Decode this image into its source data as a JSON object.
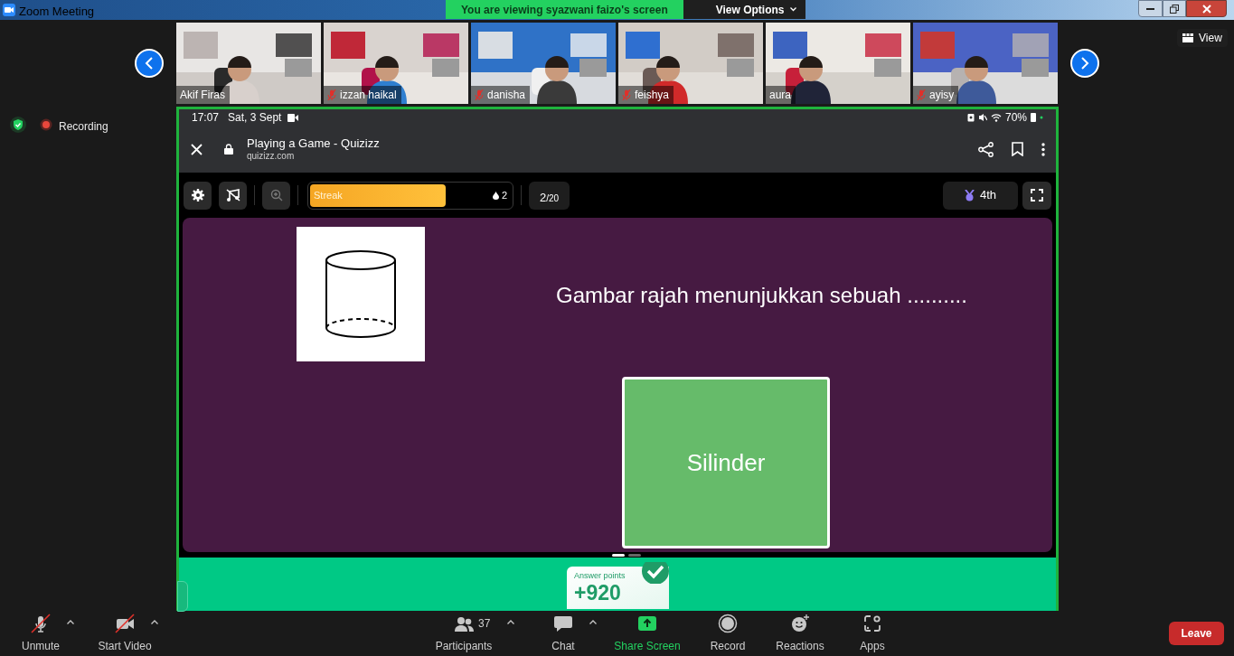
{
  "window": {
    "title": "Zoom Meeting"
  },
  "banner": {
    "text": "You are viewing syazwani faizo's screen",
    "options": "View Options"
  },
  "view_button": "View",
  "video_strip": [
    {
      "name": "Akif Firas",
      "muted": false
    },
    {
      "name": "izzan haikal",
      "muted": true
    },
    {
      "name": "danisha",
      "muted": true
    },
    {
      "name": "feishya",
      "muted": true
    },
    {
      "name": "aura",
      "muted": false
    },
    {
      "name": "ayisy",
      "muted": true
    }
  ],
  "recording": "Recording",
  "shared_screen": {
    "status_bar": {
      "time": "17:07",
      "date": "Sat, 3 Sept",
      "battery": "70%"
    },
    "browser": {
      "title": "Playing a Game - Quizizz",
      "url": "quizizz.com"
    },
    "quiz_bar": {
      "streak_label": "Streak",
      "streak": {
        "level": 0.67
      },
      "streak_count": "2",
      "question_number": "2",
      "question_total": "/20",
      "rank": "4th"
    },
    "question": "Gambar rajah menunjukkan sebuah ..........",
    "answer": "Silinder",
    "page_dots": [
      {
        "selected": true
      },
      {
        "selected": false
      }
    ],
    "answer_points": {
      "label": "Answer points",
      "value": "+920"
    }
  },
  "toolbar": [
    {
      "kind": "mic",
      "label": "Unmute",
      "off": true,
      "menu": true
    },
    {
      "kind": "video",
      "label": "Start Video",
      "off": true,
      "menu": true
    },
    {
      "kind": "participants",
      "label": "Participants",
      "count": "37",
      "menu": true
    },
    {
      "kind": "chat",
      "label": "Chat",
      "menu": true
    },
    {
      "kind": "share",
      "label": "Share Screen",
      "active": true
    },
    {
      "kind": "record",
      "label": "Record"
    },
    {
      "kind": "reactions",
      "label": "Reactions"
    },
    {
      "kind": "apps",
      "label": "Apps"
    }
  ],
  "leave_button": "Leave"
}
